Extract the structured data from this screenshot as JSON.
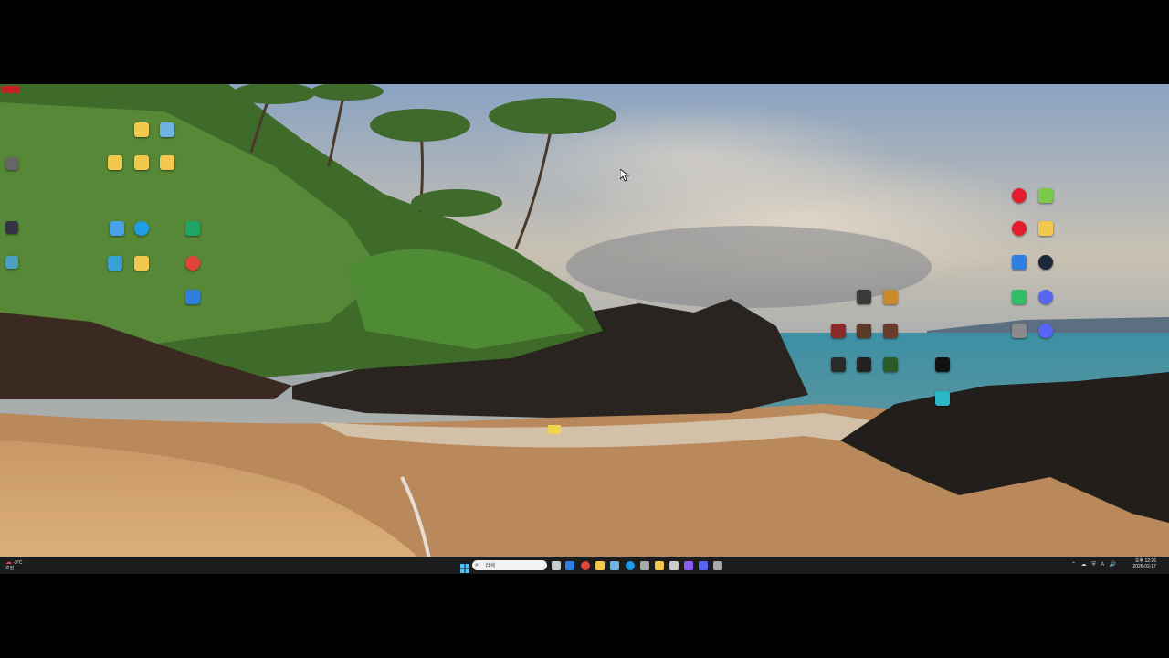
{
  "search": {
    "placeholder": "검색"
  },
  "clock": {
    "time": "오후 12:26",
    "date": "2026-02-17"
  },
  "weather": {
    "temp": "-3°C",
    "label": "흐림"
  },
  "tray": {
    "glyphs": "⌃ ☁ ⛨ A 🔊"
  },
  "desktop_icons_left": [
    {
      "name": "folder-icon",
      "color": "#f2c94c"
    },
    {
      "name": "recycle-bin-icon",
      "color": "#6fb3e0"
    },
    {
      "name": "folder-icon",
      "color": "#f2c94c"
    },
    {
      "name": "folder-icon",
      "color": "#f2c94c"
    },
    {
      "name": "folder-icon",
      "color": "#f2c94c"
    },
    {
      "name": "app-icon",
      "color": "#4aa0e6"
    },
    {
      "name": "edge-icon",
      "color": "#1e9ee8"
    },
    {
      "name": "excel-icon",
      "color": "#21a366"
    },
    {
      "name": "pc-icon",
      "color": "#3aa0d8"
    },
    {
      "name": "folder-icon",
      "color": "#f2c94c"
    },
    {
      "name": "app-red-icon",
      "color": "#e0443a"
    },
    {
      "name": "app-blue-icon",
      "color": "#2f7fe0"
    }
  ],
  "desktop_icons_right": [
    {
      "name": "app-red-icon",
      "color": "#e21e2e"
    },
    {
      "name": "app-green-icon",
      "color": "#7ac94a"
    },
    {
      "name": "app-red-icon",
      "color": "#e21e2e"
    },
    {
      "name": "folder-icon",
      "color": "#f2c94c"
    },
    {
      "name": "app-blue-icon",
      "color": "#2f7fe0"
    },
    {
      "name": "steam-icon",
      "color": "#1b2838"
    },
    {
      "name": "app-green-icon",
      "color": "#2fbf6a"
    },
    {
      "name": "discord-icon",
      "color": "#5865f2"
    },
    {
      "name": "app-grey-icon",
      "color": "#8a8a8a"
    },
    {
      "name": "discord-icon",
      "color": "#5865f2"
    }
  ],
  "desktop_icons_mid": [
    {
      "name": "game-icon",
      "color": "#3a3a3a"
    },
    {
      "name": "game-icon",
      "color": "#c98a2a"
    },
    {
      "name": "game-icon",
      "color": "#8a2a2a"
    },
    {
      "name": "game-icon",
      "color": "#5a3a2a"
    },
    {
      "name": "game-icon",
      "color": "#6a3a2a"
    },
    {
      "name": "game-icon",
      "color": "#2a2a2a"
    },
    {
      "name": "game-icon",
      "color": "#222222"
    },
    {
      "name": "game-icon",
      "color": "#2a5a2a"
    },
    {
      "name": "game-icon",
      "color": "#111111"
    },
    {
      "name": "game-icon",
      "color": "#2ab8c8"
    }
  ],
  "taskbar_apps": [
    {
      "name": "start-icon",
      "color": "#3aa0f0"
    },
    {
      "name": "task-view-icon",
      "color": "#cccccc"
    },
    {
      "name": "store-icon",
      "color": "#2f7fe0"
    },
    {
      "name": "chrome-icon",
      "color": "#e0443a"
    },
    {
      "name": "explorer-icon",
      "color": "#f2c94c"
    },
    {
      "name": "app-icon",
      "color": "#6fb3e0"
    },
    {
      "name": "edge-icon",
      "color": "#1e9ee8"
    },
    {
      "name": "app-icon",
      "color": "#aaaaaa"
    },
    {
      "name": "app-icon",
      "color": "#f2c94c"
    },
    {
      "name": "app-icon",
      "color": "#cccccc"
    },
    {
      "name": "app-icon",
      "color": "#8b5cf6"
    },
    {
      "name": "app-icon",
      "color": "#5865f2"
    },
    {
      "name": "app-icon",
      "color": "#aaaaaa"
    }
  ]
}
